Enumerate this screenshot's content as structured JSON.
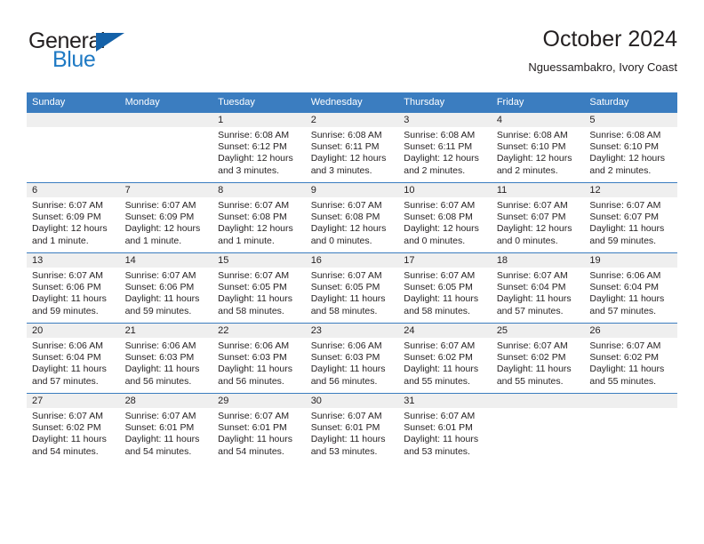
{
  "brand": {
    "name_top": "General",
    "name_bottom": "Blue",
    "triangle_icon": "blue-triangle-logo-mark",
    "color_dark": "#231f20",
    "color_blue": "#1f7ac4",
    "color_triangle": "#1461a8"
  },
  "header": {
    "title": "October 2024",
    "subtitle": "Nguessambakro, Ivory Coast"
  },
  "theme": {
    "header_row_bg": "#3b7dc0",
    "daynum_band_bg": "#efefef",
    "cell_bg": "#ffffff",
    "row_divider": "#3b7dc0",
    "text": "#231f20"
  },
  "weekdays": [
    "Sunday",
    "Monday",
    "Tuesday",
    "Wednesday",
    "Thursday",
    "Friday",
    "Saturday"
  ],
  "weeks": [
    [
      {
        "empty": true
      },
      {
        "empty": true
      },
      {
        "day": "1",
        "sunrise": "Sunrise: 6:08 AM",
        "sunset": "Sunset: 6:12 PM",
        "daylight": "Daylight: 12 hours and 3 minutes."
      },
      {
        "day": "2",
        "sunrise": "Sunrise: 6:08 AM",
        "sunset": "Sunset: 6:11 PM",
        "daylight": "Daylight: 12 hours and 3 minutes."
      },
      {
        "day": "3",
        "sunrise": "Sunrise: 6:08 AM",
        "sunset": "Sunset: 6:11 PM",
        "daylight": "Daylight: 12 hours and 2 minutes."
      },
      {
        "day": "4",
        "sunrise": "Sunrise: 6:08 AM",
        "sunset": "Sunset: 6:10 PM",
        "daylight": "Daylight: 12 hours and 2 minutes."
      },
      {
        "day": "5",
        "sunrise": "Sunrise: 6:08 AM",
        "sunset": "Sunset: 6:10 PM",
        "daylight": "Daylight: 12 hours and 2 minutes."
      }
    ],
    [
      {
        "day": "6",
        "sunrise": "Sunrise: 6:07 AM",
        "sunset": "Sunset: 6:09 PM",
        "daylight": "Daylight: 12 hours and 1 minute."
      },
      {
        "day": "7",
        "sunrise": "Sunrise: 6:07 AM",
        "sunset": "Sunset: 6:09 PM",
        "daylight": "Daylight: 12 hours and 1 minute."
      },
      {
        "day": "8",
        "sunrise": "Sunrise: 6:07 AM",
        "sunset": "Sunset: 6:08 PM",
        "daylight": "Daylight: 12 hours and 1 minute."
      },
      {
        "day": "9",
        "sunrise": "Sunrise: 6:07 AM",
        "sunset": "Sunset: 6:08 PM",
        "daylight": "Daylight: 12 hours and 0 minutes."
      },
      {
        "day": "10",
        "sunrise": "Sunrise: 6:07 AM",
        "sunset": "Sunset: 6:08 PM",
        "daylight": "Daylight: 12 hours and 0 minutes."
      },
      {
        "day": "11",
        "sunrise": "Sunrise: 6:07 AM",
        "sunset": "Sunset: 6:07 PM",
        "daylight": "Daylight: 12 hours and 0 minutes."
      },
      {
        "day": "12",
        "sunrise": "Sunrise: 6:07 AM",
        "sunset": "Sunset: 6:07 PM",
        "daylight": "Daylight: 11 hours and 59 minutes."
      }
    ],
    [
      {
        "day": "13",
        "sunrise": "Sunrise: 6:07 AM",
        "sunset": "Sunset: 6:06 PM",
        "daylight": "Daylight: 11 hours and 59 minutes."
      },
      {
        "day": "14",
        "sunrise": "Sunrise: 6:07 AM",
        "sunset": "Sunset: 6:06 PM",
        "daylight": "Daylight: 11 hours and 59 minutes."
      },
      {
        "day": "15",
        "sunrise": "Sunrise: 6:07 AM",
        "sunset": "Sunset: 6:05 PM",
        "daylight": "Daylight: 11 hours and 58 minutes."
      },
      {
        "day": "16",
        "sunrise": "Sunrise: 6:07 AM",
        "sunset": "Sunset: 6:05 PM",
        "daylight": "Daylight: 11 hours and 58 minutes."
      },
      {
        "day": "17",
        "sunrise": "Sunrise: 6:07 AM",
        "sunset": "Sunset: 6:05 PM",
        "daylight": "Daylight: 11 hours and 58 minutes."
      },
      {
        "day": "18",
        "sunrise": "Sunrise: 6:07 AM",
        "sunset": "Sunset: 6:04 PM",
        "daylight": "Daylight: 11 hours and 57 minutes."
      },
      {
        "day": "19",
        "sunrise": "Sunrise: 6:06 AM",
        "sunset": "Sunset: 6:04 PM",
        "daylight": "Daylight: 11 hours and 57 minutes."
      }
    ],
    [
      {
        "day": "20",
        "sunrise": "Sunrise: 6:06 AM",
        "sunset": "Sunset: 6:04 PM",
        "daylight": "Daylight: 11 hours and 57 minutes."
      },
      {
        "day": "21",
        "sunrise": "Sunrise: 6:06 AM",
        "sunset": "Sunset: 6:03 PM",
        "daylight": "Daylight: 11 hours and 56 minutes."
      },
      {
        "day": "22",
        "sunrise": "Sunrise: 6:06 AM",
        "sunset": "Sunset: 6:03 PM",
        "daylight": "Daylight: 11 hours and 56 minutes."
      },
      {
        "day": "23",
        "sunrise": "Sunrise: 6:06 AM",
        "sunset": "Sunset: 6:03 PM",
        "daylight": "Daylight: 11 hours and 56 minutes."
      },
      {
        "day": "24",
        "sunrise": "Sunrise: 6:07 AM",
        "sunset": "Sunset: 6:02 PM",
        "daylight": "Daylight: 11 hours and 55 minutes."
      },
      {
        "day": "25",
        "sunrise": "Sunrise: 6:07 AM",
        "sunset": "Sunset: 6:02 PM",
        "daylight": "Daylight: 11 hours and 55 minutes."
      },
      {
        "day": "26",
        "sunrise": "Sunrise: 6:07 AM",
        "sunset": "Sunset: 6:02 PM",
        "daylight": "Daylight: 11 hours and 55 minutes."
      }
    ],
    [
      {
        "day": "27",
        "sunrise": "Sunrise: 6:07 AM",
        "sunset": "Sunset: 6:02 PM",
        "daylight": "Daylight: 11 hours and 54 minutes."
      },
      {
        "day": "28",
        "sunrise": "Sunrise: 6:07 AM",
        "sunset": "Sunset: 6:01 PM",
        "daylight": "Daylight: 11 hours and 54 minutes."
      },
      {
        "day": "29",
        "sunrise": "Sunrise: 6:07 AM",
        "sunset": "Sunset: 6:01 PM",
        "daylight": "Daylight: 11 hours and 54 minutes."
      },
      {
        "day": "30",
        "sunrise": "Sunrise: 6:07 AM",
        "sunset": "Sunset: 6:01 PM",
        "daylight": "Daylight: 11 hours and 53 minutes."
      },
      {
        "day": "31",
        "sunrise": "Sunrise: 6:07 AM",
        "sunset": "Sunset: 6:01 PM",
        "daylight": "Daylight: 11 hours and 53 minutes."
      },
      {
        "empty": true
      },
      {
        "empty": true
      }
    ]
  ]
}
